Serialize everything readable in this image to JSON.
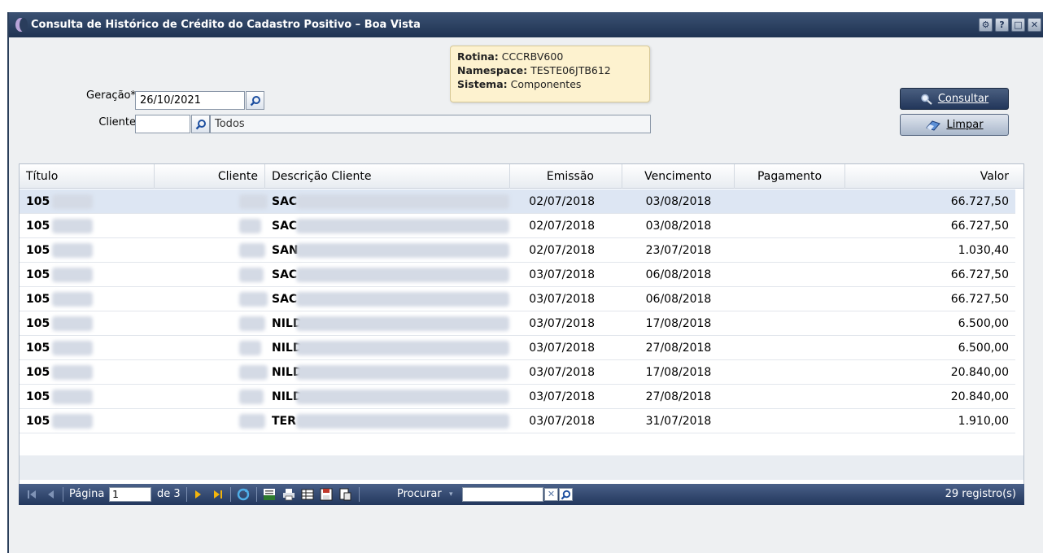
{
  "window": {
    "title": "Consulta de Histórico de Crédito do Cadastro Positivo – Boa Vista",
    "buttons": [
      "settings-icon",
      "help-icon",
      "maximize-icon",
      "close-icon"
    ]
  },
  "tooltip": {
    "rotina_label": "Rotina:",
    "rotina_value": "CCCRBV600",
    "namespace_label": "Namespace:",
    "namespace_value": "TESTE06JTB612",
    "sistema_label": "Sistema:",
    "sistema_value": "Componentes"
  },
  "form": {
    "geracao_label": "Geração*",
    "geracao_value": "26/10/2021",
    "cliente_label": "Cliente",
    "cliente_value": "",
    "cliente_desc": "Todos"
  },
  "actions": {
    "consultar": "Consultar",
    "limpar": "Limpar"
  },
  "grid": {
    "columns": [
      "Título",
      "Cliente",
      "Descrição Cliente",
      "Emissão",
      "Vencimento",
      "Pagamento",
      "Valor"
    ],
    "rows": [
      {
        "titulo": "105",
        "desc": "SAC",
        "emissao": "02/07/2018",
        "vencimento": "03/08/2018",
        "pagamento": "",
        "valor": "66.727,50"
      },
      {
        "titulo": "105",
        "desc": "SAC",
        "emissao": "02/07/2018",
        "vencimento": "03/08/2018",
        "pagamento": "",
        "valor": "66.727,50"
      },
      {
        "titulo": "105",
        "desc": "SAN",
        "emissao": "02/07/2018",
        "vencimento": "23/07/2018",
        "pagamento": "",
        "valor": "1.030,40"
      },
      {
        "titulo": "105",
        "desc": "SAC",
        "emissao": "03/07/2018",
        "vencimento": "06/08/2018",
        "pagamento": "",
        "valor": "66.727,50"
      },
      {
        "titulo": "105",
        "desc": "SAC",
        "emissao": "03/07/2018",
        "vencimento": "06/08/2018",
        "pagamento": "",
        "valor": "66.727,50"
      },
      {
        "titulo": "105",
        "desc": "NILD",
        "emissao": "03/07/2018",
        "vencimento": "17/08/2018",
        "pagamento": "",
        "valor": "6.500,00"
      },
      {
        "titulo": "105",
        "desc": "NILD",
        "emissao": "03/07/2018",
        "vencimento": "27/08/2018",
        "pagamento": "",
        "valor": "6.500,00"
      },
      {
        "titulo": "105",
        "desc": "NILD",
        "emissao": "03/07/2018",
        "vencimento": "17/08/2018",
        "pagamento": "",
        "valor": "20.840,00"
      },
      {
        "titulo": "105",
        "desc": "NILD",
        "emissao": "03/07/2018",
        "vencimento": "27/08/2018",
        "pagamento": "",
        "valor": "20.840,00"
      },
      {
        "titulo": "105",
        "desc": "TER",
        "emissao": "03/07/2018",
        "vencimento": "31/07/2018",
        "pagamento": "",
        "valor": "1.910,00"
      }
    ]
  },
  "pager": {
    "pagina_label": "Página",
    "pagina_value": "1",
    "de_label": "de 3",
    "procurar_label": "Procurar",
    "search_value": "",
    "registros": "29 registro(s)"
  },
  "colors": {
    "titlebar": "#2b3f5f",
    "pager": "#2f4670",
    "selected_row": "#dde6f3",
    "tooltip_bg": "#fdf2cf"
  }
}
